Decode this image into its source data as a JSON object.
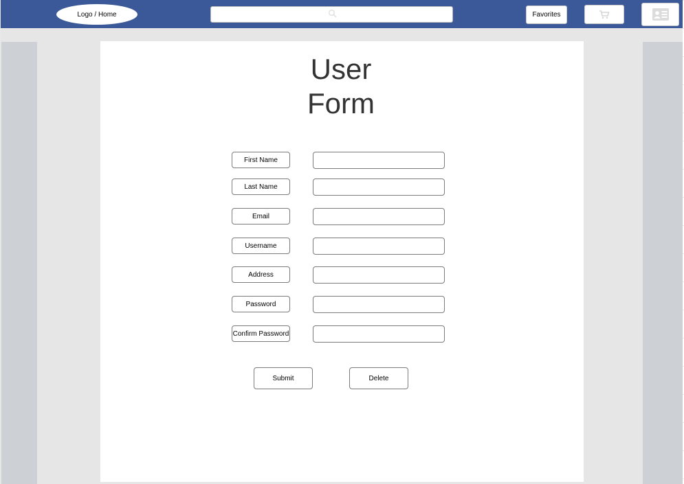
{
  "header": {
    "logo_label": "Logo / Home",
    "search": {
      "value": "",
      "icon": "search-icon"
    },
    "favorites_label": "Favorites",
    "cart_icon": "cart-icon",
    "profile_icon": "id-card-icon"
  },
  "form": {
    "title_line1": "User",
    "title_line2": "Form",
    "fields": [
      {
        "label": "First Name",
        "value": ""
      },
      {
        "label": "Last Name",
        "value": ""
      },
      {
        "label": "Email",
        "value": ""
      },
      {
        "label": "Username",
        "value": ""
      },
      {
        "label": "Address",
        "value": ""
      },
      {
        "label": "Password",
        "value": ""
      },
      {
        "label": "Confirm Password",
        "value": ""
      }
    ],
    "submit_label": "Submit",
    "delete_label": "Delete"
  },
  "colors": {
    "header_bg": "#3b5998",
    "band_bg": "#e6e6e6",
    "side_col": "#cdd0d5",
    "panel_bg": "#ffffff"
  }
}
